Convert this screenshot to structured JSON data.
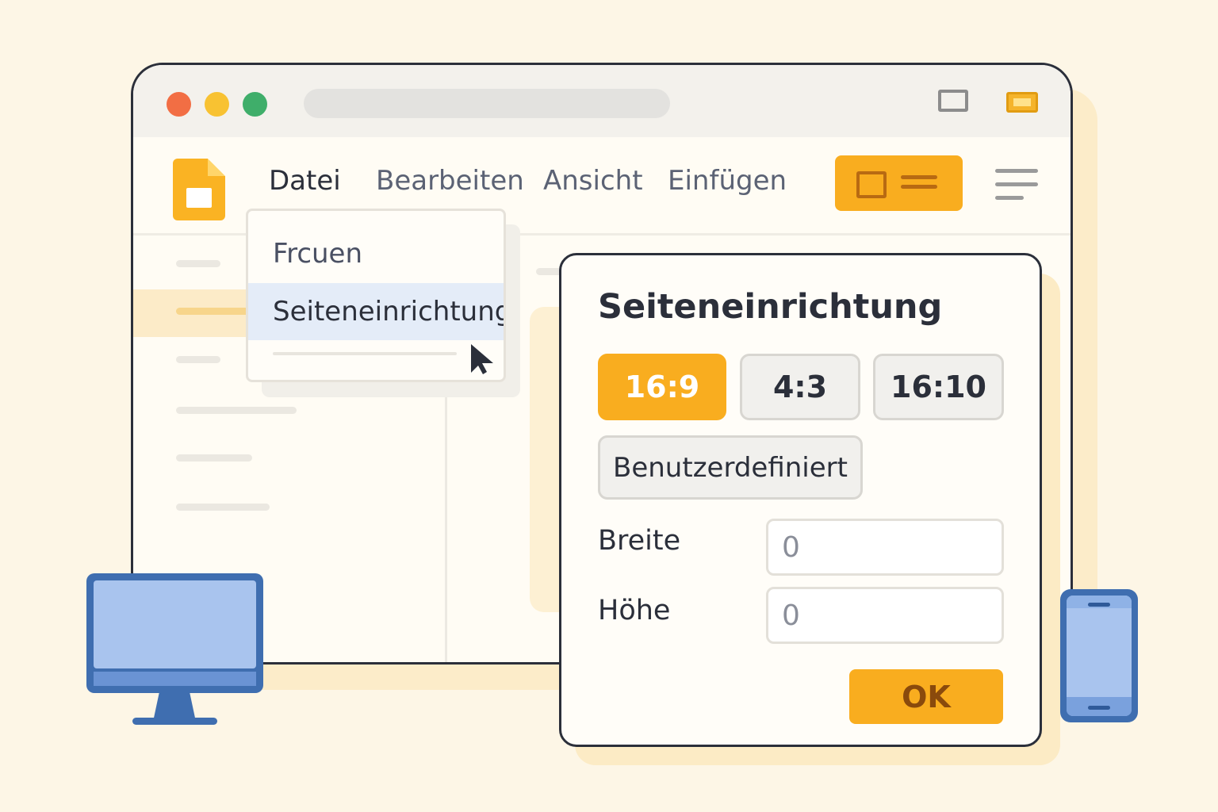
{
  "colors": {
    "accent": "#f9ad1f",
    "background": "#fdf6e6",
    "outline": "#2b2f3a",
    "device_blue": "#3f6eb0",
    "selection": "#e4ecf8"
  },
  "window": {
    "traffic_lights": [
      "#f26e44",
      "#f8c232",
      "#3fae6a"
    ]
  },
  "menubar": {
    "items": [
      {
        "label": "Datei",
        "active": true
      },
      {
        "label": "Bearbeiten",
        "active": false
      },
      {
        "label": "Ansicht",
        "active": false
      },
      {
        "label": "Einfügen",
        "active": false
      }
    ],
    "layout_button_icon": "slide-layout-icon",
    "hamburger_icon": "hamburger-menu-icon"
  },
  "dropdown": {
    "items": [
      {
        "label": "Frcuen",
        "selected": false
      },
      {
        "label": "Seiteneinrichtung",
        "selected": true
      }
    ]
  },
  "dialog": {
    "title": "Seiteneinrichtung",
    "ratios": [
      {
        "label": "16:9",
        "selected": true
      },
      {
        "label": "4:3",
        "selected": false
      },
      {
        "label": "16:10",
        "selected": false
      }
    ],
    "custom_label": "Benutzerdefiniert",
    "width_label": "Breite",
    "width_value": "0",
    "height_label": "Höhe",
    "height_value": "0",
    "ok_label": "OK"
  }
}
